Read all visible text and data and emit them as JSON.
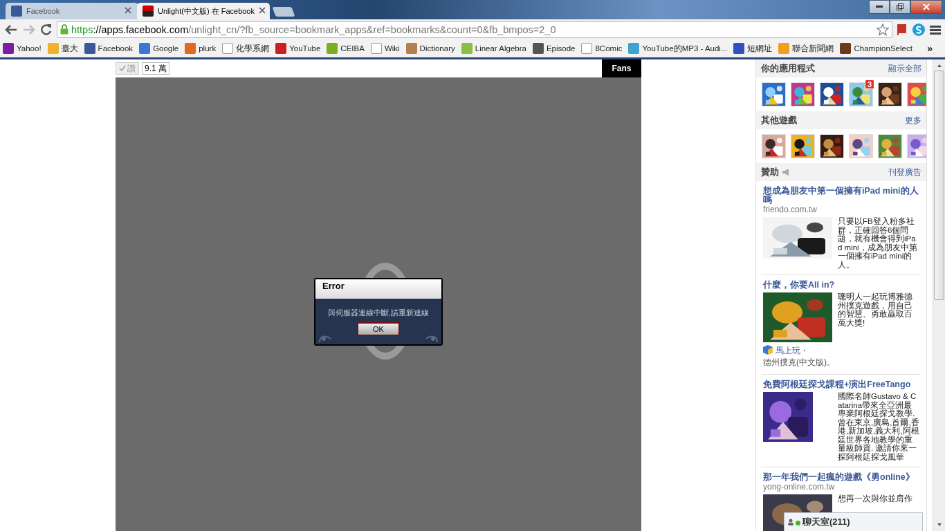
{
  "tabs": [
    {
      "label": "Facebook",
      "selected": false
    },
    {
      "label": "Unlight(中文版) 在 Facebook",
      "selected": true
    }
  ],
  "address": {
    "scheme": "https",
    "host": "://apps.facebook.com",
    "path": "/unlight_cn/?fb_source=bookmark_apps&ref=bookmarks&count=0&fb_bmpos=2_0"
  },
  "bookmarks": [
    {
      "label": "Yahoo!"
    },
    {
      "label": "臺大"
    },
    {
      "label": "Facebook"
    },
    {
      "label": "Google"
    },
    {
      "label": "plurk"
    },
    {
      "label": "化學系網"
    },
    {
      "label": "YouTube"
    },
    {
      "label": "CEIBA"
    },
    {
      "label": "Wiki"
    },
    {
      "label": "Dictionary"
    },
    {
      "label": "Linear Algebra"
    },
    {
      "label": "Episode"
    },
    {
      "label": "8Comic"
    },
    {
      "label": "YouTube的MP3 - Audi..."
    },
    {
      "label": "短網址"
    },
    {
      "label": "聯合新聞網"
    },
    {
      "label": "ChampionSelect"
    }
  ],
  "bookmarks_more": "»",
  "game": {
    "like_button": "讚",
    "like_count": "9.1 萬",
    "fans_tab": "Fans",
    "dialog": {
      "title": "Error",
      "message": "與伺服器連線中斷,請重新連線",
      "button": "OK"
    }
  },
  "sidebar": {
    "sections": [
      {
        "title": "你的應用程式",
        "link": "顯示全部",
        "items": [
          {
            "kind": "picture"
          },
          {
            "kind": "picture"
          },
          {
            "kind": "picture"
          },
          {
            "kind": "picture",
            "badge": "3"
          },
          {
            "kind": "picture"
          },
          {
            "kind": "picture"
          }
        ]
      },
      {
        "title": "其他遊戲",
        "link": "更多",
        "items": [
          {
            "kind": "picture"
          },
          {
            "kind": "picture"
          },
          {
            "kind": "picture"
          },
          {
            "kind": "picture"
          },
          {
            "kind": "picture"
          },
          {
            "kind": "picture"
          }
        ]
      }
    ],
    "sponsored": {
      "title": "贊助",
      "link": "刊登廣告"
    },
    "ads": [
      {
        "title": "想成為朋友中第一個擁有iPad mini的人嗎",
        "domain": "friendo.com.tw",
        "text": "只要以FB登入粉多社群，正確回答6個問題，就有機會得到iPad mini，成為朋友中第一個擁有iPad mini的人。"
      },
      {
        "title": "什麼，你要All in?",
        "text": "聰明人一起玩博雅德州撲克遊戲，用自己的智慧、勇敢贏取百萬大獎!",
        "play_link": "馬上玩・",
        "play_text": "德州撲克(中文版)。"
      },
      {
        "title": "免費阿根廷探戈課程+演出FreeTango",
        "text": "國際名師Gustavo & Catarina帶來全亞洲最專業阿根廷探戈教學.曾在東京,廣島,首爾,香港,新加坡,義大利,阿根廷世界各地教學的重量級師資. 邀請你來一探阿根廷探戈風華"
      },
      {
        "title": "那一年我們一起瘋的遊戲《勇online》",
        "domain": "yong-online.com.tw",
        "text": "想再一次與你並肩作"
      }
    ]
  },
  "chat": {
    "label": "聊天室(211)"
  }
}
